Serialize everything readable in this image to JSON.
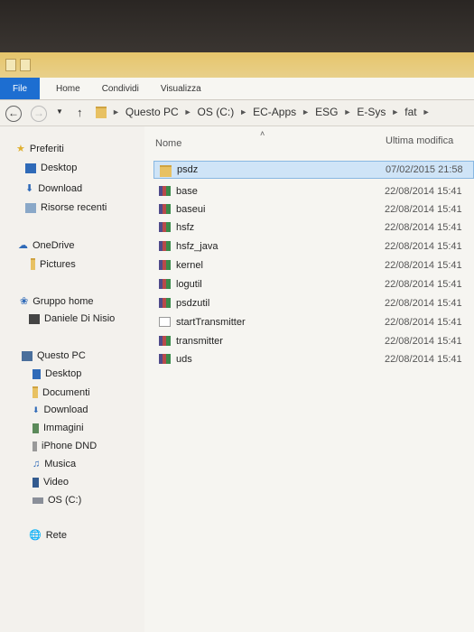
{
  "ribbon": {
    "tabs": [
      "File",
      "Home",
      "Condividi",
      "Visualizza"
    ]
  },
  "address": {
    "crumbs": [
      "Questo PC",
      "OS (C:)",
      "EC-Apps",
      "ESG",
      "E-Sys",
      "fat"
    ]
  },
  "nav": {
    "favorites_label": "Preferiti",
    "favorites": [
      "Desktop",
      "Download",
      "Risorse recenti"
    ],
    "onedrive_label": "OneDrive",
    "onedrive_items": [
      "Pictures"
    ],
    "homegroup_label": "Gruppo home",
    "homegroup_items": [
      "Daniele Di Nisio"
    ],
    "pc_label": "Questo PC",
    "pc_items": [
      "Desktop",
      "Documenti",
      "Download",
      "Immagini",
      "iPhone DND",
      "Musica",
      "Video",
      "OS (C:)"
    ],
    "network_label": "Rete"
  },
  "columns": {
    "name": "Nome",
    "modified": "Ultima modifica"
  },
  "files": [
    {
      "name": "psdz",
      "modified": "07/02/2015 21:58",
      "icon": "folder-icon"
    },
    {
      "name": "base",
      "modified": "22/08/2014 15:41",
      "icon": "exe-icon"
    },
    {
      "name": "baseui",
      "modified": "22/08/2014 15:41",
      "icon": "exe-icon"
    },
    {
      "name": "hsfz",
      "modified": "22/08/2014 15:41",
      "icon": "exe-icon"
    },
    {
      "name": "hsfz_java",
      "modified": "22/08/2014 15:41",
      "icon": "exe-icon"
    },
    {
      "name": "kernel",
      "modified": "22/08/2014 15:41",
      "icon": "exe-icon"
    },
    {
      "name": "logutil",
      "modified": "22/08/2014 15:41",
      "icon": "exe-icon"
    },
    {
      "name": "psdzutil",
      "modified": "22/08/2014 15:41",
      "icon": "exe-icon"
    },
    {
      "name": "startTransmitter",
      "modified": "22/08/2014 15:41",
      "icon": "doc-icon"
    },
    {
      "name": "transmitter",
      "modified": "22/08/2014 15:41",
      "icon": "exe-icon"
    },
    {
      "name": "uds",
      "modified": "22/08/2014 15:41",
      "icon": "exe-icon"
    }
  ]
}
